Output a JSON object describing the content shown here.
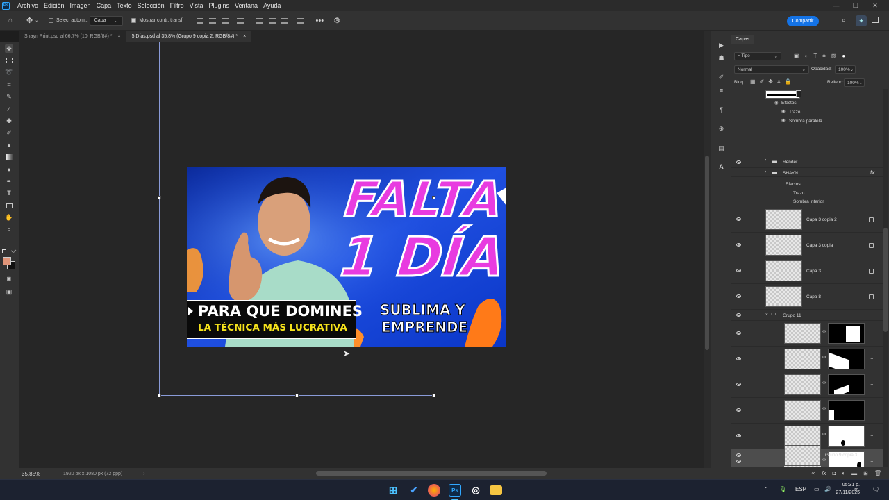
{
  "menubar": {
    "app_logo": "Ps",
    "items": [
      "Archivo",
      "Edición",
      "Imagen",
      "Capa",
      "Texto",
      "Selección",
      "Filtro",
      "Vista",
      "Plugins",
      "Ventana",
      "Ayuda"
    ]
  },
  "options": {
    "auto_select_label": "Selec. autom.:",
    "auto_select_value": "Capa",
    "show_transform_label": "Mostrar contr. transf.",
    "share_label": "Compartir"
  },
  "tabs": [
    {
      "label": "Shayn Print.psd al 66.7% (10, RGB/8#) *",
      "close": "×"
    },
    {
      "label": "5 Días.psd al 35.8% (Grupo 9 copia 2, RGB/8#) *",
      "close": "×"
    }
  ],
  "thumbnail": {
    "headline_1": "FALTA",
    "headline_2": "1 DÍA",
    "banner_line_1": "PARA QUE DOMINES",
    "banner_line_2": "LA TÉCNICA MÁS LUCRATIVA",
    "side_line_1": "SUBLIMA Y",
    "side_line_2": "EMPRENDE"
  },
  "status": {
    "zoom": "35.85%",
    "doc_size": "1920 px x 1080 px (72 ppp)"
  },
  "layers_panel": {
    "tab": "Capas",
    "filter_label": "Tipo",
    "blend_mode": "Normal",
    "opacity_label": "Opacidad:",
    "opacity_value": "100%",
    "lock_label": "Bloq.:",
    "fill_label": "Relleno:",
    "fill_value": "100%",
    "rows": [
      {
        "name": "Efectos"
      },
      {
        "name": "Trazo"
      },
      {
        "name": "Sombra paralela"
      },
      {
        "name": "Render"
      },
      {
        "name": "SHAYN"
      },
      {
        "name": "Efectos"
      },
      {
        "name": "Trazo"
      },
      {
        "name": "Sombra interior"
      },
      {
        "name": "Capa 3 copia 2"
      },
      {
        "name": "Capa 3 copia"
      },
      {
        "name": "Capa 3"
      },
      {
        "name": "Capa 8"
      },
      {
        "name": "Grupo 11"
      },
      {
        "name": "Grupo 9 copia 3"
      }
    ],
    "fx": "fx"
  },
  "taskbar": {
    "lang": "ESP",
    "time": "05:31 p. m.",
    "date": "27/11/2025"
  }
}
